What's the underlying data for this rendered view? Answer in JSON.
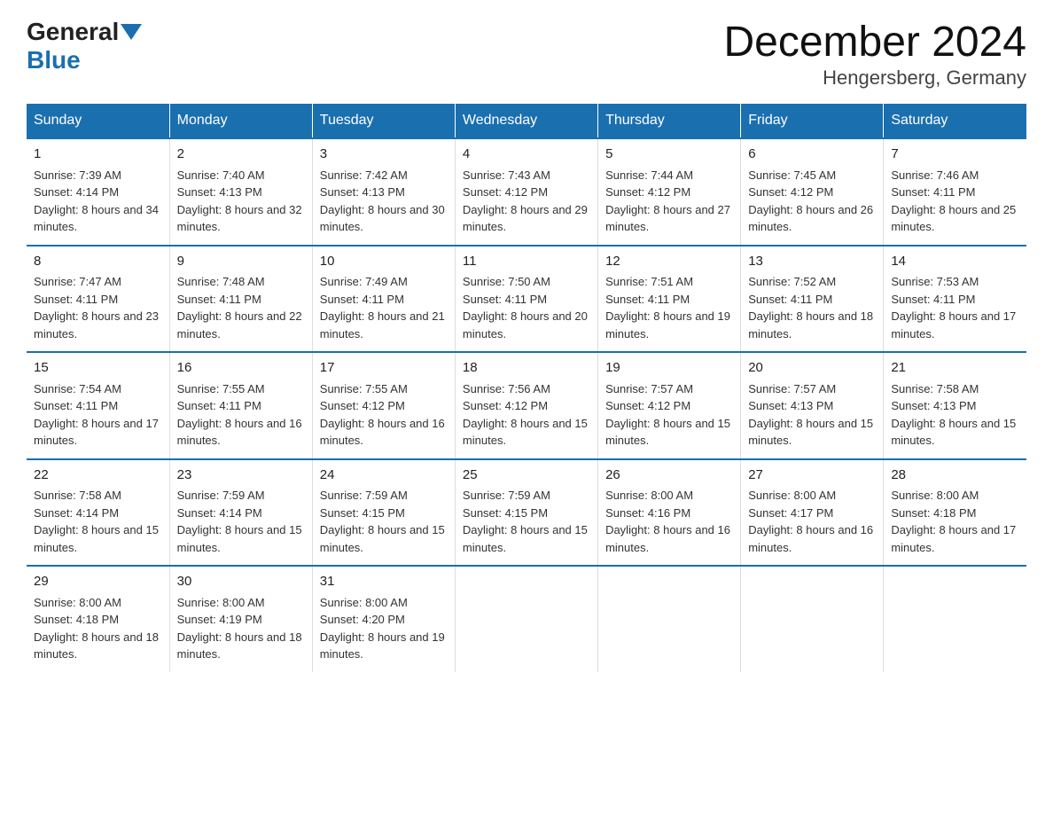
{
  "header": {
    "logo_general": "General",
    "logo_blue": "Blue",
    "title": "December 2024",
    "subtitle": "Hengersberg, Germany"
  },
  "days_of_week": [
    "Sunday",
    "Monday",
    "Tuesday",
    "Wednesday",
    "Thursday",
    "Friday",
    "Saturday"
  ],
  "weeks": [
    [
      {
        "day": "1",
        "sunrise": "7:39 AM",
        "sunset": "4:14 PM",
        "daylight": "8 hours and 34 minutes."
      },
      {
        "day": "2",
        "sunrise": "7:40 AM",
        "sunset": "4:13 PM",
        "daylight": "8 hours and 32 minutes."
      },
      {
        "day": "3",
        "sunrise": "7:42 AM",
        "sunset": "4:13 PM",
        "daylight": "8 hours and 30 minutes."
      },
      {
        "day": "4",
        "sunrise": "7:43 AM",
        "sunset": "4:12 PM",
        "daylight": "8 hours and 29 minutes."
      },
      {
        "day": "5",
        "sunrise": "7:44 AM",
        "sunset": "4:12 PM",
        "daylight": "8 hours and 27 minutes."
      },
      {
        "day": "6",
        "sunrise": "7:45 AM",
        "sunset": "4:12 PM",
        "daylight": "8 hours and 26 minutes."
      },
      {
        "day": "7",
        "sunrise": "7:46 AM",
        "sunset": "4:11 PM",
        "daylight": "8 hours and 25 minutes."
      }
    ],
    [
      {
        "day": "8",
        "sunrise": "7:47 AM",
        "sunset": "4:11 PM",
        "daylight": "8 hours and 23 minutes."
      },
      {
        "day": "9",
        "sunrise": "7:48 AM",
        "sunset": "4:11 PM",
        "daylight": "8 hours and 22 minutes."
      },
      {
        "day": "10",
        "sunrise": "7:49 AM",
        "sunset": "4:11 PM",
        "daylight": "8 hours and 21 minutes."
      },
      {
        "day": "11",
        "sunrise": "7:50 AM",
        "sunset": "4:11 PM",
        "daylight": "8 hours and 20 minutes."
      },
      {
        "day": "12",
        "sunrise": "7:51 AM",
        "sunset": "4:11 PM",
        "daylight": "8 hours and 19 minutes."
      },
      {
        "day": "13",
        "sunrise": "7:52 AM",
        "sunset": "4:11 PM",
        "daylight": "8 hours and 18 minutes."
      },
      {
        "day": "14",
        "sunrise": "7:53 AM",
        "sunset": "4:11 PM",
        "daylight": "8 hours and 17 minutes."
      }
    ],
    [
      {
        "day": "15",
        "sunrise": "7:54 AM",
        "sunset": "4:11 PM",
        "daylight": "8 hours and 17 minutes."
      },
      {
        "day": "16",
        "sunrise": "7:55 AM",
        "sunset": "4:11 PM",
        "daylight": "8 hours and 16 minutes."
      },
      {
        "day": "17",
        "sunrise": "7:55 AM",
        "sunset": "4:12 PM",
        "daylight": "8 hours and 16 minutes."
      },
      {
        "day": "18",
        "sunrise": "7:56 AM",
        "sunset": "4:12 PM",
        "daylight": "8 hours and 15 minutes."
      },
      {
        "day": "19",
        "sunrise": "7:57 AM",
        "sunset": "4:12 PM",
        "daylight": "8 hours and 15 minutes."
      },
      {
        "day": "20",
        "sunrise": "7:57 AM",
        "sunset": "4:13 PM",
        "daylight": "8 hours and 15 minutes."
      },
      {
        "day": "21",
        "sunrise": "7:58 AM",
        "sunset": "4:13 PM",
        "daylight": "8 hours and 15 minutes."
      }
    ],
    [
      {
        "day": "22",
        "sunrise": "7:58 AM",
        "sunset": "4:14 PM",
        "daylight": "8 hours and 15 minutes."
      },
      {
        "day": "23",
        "sunrise": "7:59 AM",
        "sunset": "4:14 PM",
        "daylight": "8 hours and 15 minutes."
      },
      {
        "day": "24",
        "sunrise": "7:59 AM",
        "sunset": "4:15 PM",
        "daylight": "8 hours and 15 minutes."
      },
      {
        "day": "25",
        "sunrise": "7:59 AM",
        "sunset": "4:15 PM",
        "daylight": "8 hours and 15 minutes."
      },
      {
        "day": "26",
        "sunrise": "8:00 AM",
        "sunset": "4:16 PM",
        "daylight": "8 hours and 16 minutes."
      },
      {
        "day": "27",
        "sunrise": "8:00 AM",
        "sunset": "4:17 PM",
        "daylight": "8 hours and 16 minutes."
      },
      {
        "day": "28",
        "sunrise": "8:00 AM",
        "sunset": "4:18 PM",
        "daylight": "8 hours and 17 minutes."
      }
    ],
    [
      {
        "day": "29",
        "sunrise": "8:00 AM",
        "sunset": "4:18 PM",
        "daylight": "8 hours and 18 minutes."
      },
      {
        "day": "30",
        "sunrise": "8:00 AM",
        "sunset": "4:19 PM",
        "daylight": "8 hours and 18 minutes."
      },
      {
        "day": "31",
        "sunrise": "8:00 AM",
        "sunset": "4:20 PM",
        "daylight": "8 hours and 19 minutes."
      },
      null,
      null,
      null,
      null
    ]
  ]
}
